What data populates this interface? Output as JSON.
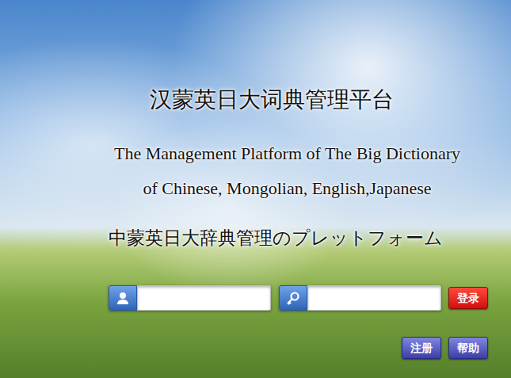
{
  "title": "汉蒙英日大词典管理平台",
  "subtitle_en": [
    "The Management Platform of The Big Dictionary",
    "of Chinese, Mongolian, English,Japanese"
  ],
  "subtitle_ja": "中蒙英日大辞典管理のプレットフォーム",
  "fields": [
    {
      "kind": "username"
    },
    {
      "kind": "password"
    }
  ],
  "login_button": "登录",
  "buttons": [
    "注册",
    "帮助"
  ]
}
